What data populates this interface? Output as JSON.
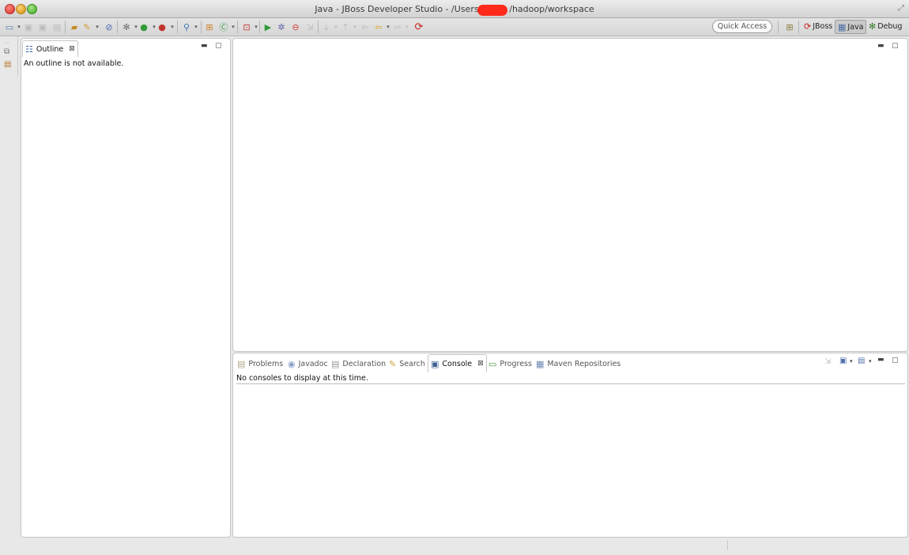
{
  "window": {
    "title": "Java - JBoss Developer Studio - /Users/          /hadoop/workspace"
  },
  "toolbar": {
    "quick_access": "Quick Access",
    "perspectives": [
      "JBoss",
      "Java",
      "Debug"
    ],
    "active_perspective": "Java"
  },
  "outline": {
    "tab_label": "Outline",
    "message": "An outline is not available."
  },
  "bottom_panel": {
    "tabs": [
      "Problems",
      "Javadoc",
      "Declaration",
      "Search",
      "Console",
      "Progress",
      "Maven Repositories"
    ],
    "active_tab": "Console",
    "message": "No consoles to display at this time."
  },
  "colors": {
    "redaction": "#ff2a1a",
    "panel_border": "#c5c5c5",
    "background": "#e8e8e8"
  }
}
